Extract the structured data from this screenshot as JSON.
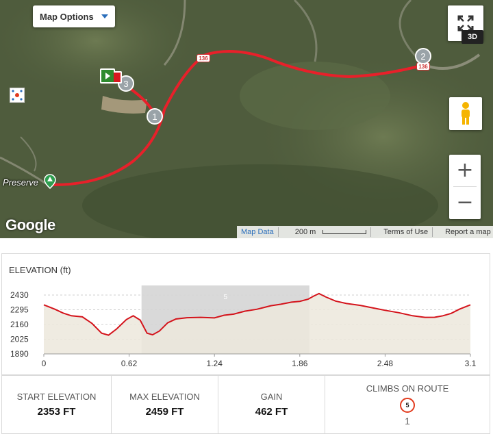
{
  "map": {
    "options_label": "Map Options",
    "btn_3d": "3D",
    "zoom_in": "+",
    "zoom_out": "−",
    "place_label": "Preserve",
    "google_logo": "Google",
    "road_shield_1": "136",
    "road_shield_2": "136",
    "waypoints": [
      "1",
      "2",
      "3"
    ],
    "attribution": {
      "map_data": "Map Data",
      "scale": "200 m",
      "terms": "Terms of Use",
      "report": "Report a map error"
    },
    "colors": {
      "route": "#e8202a",
      "link": "#2a6ebb"
    },
    "icons": [
      "fullscreen-icon",
      "pegman-icon",
      "compass-icon",
      "start-flag-icon",
      "end-marker-icon"
    ]
  },
  "elevation": {
    "title": "ELEVATION (ft)",
    "highlight_label": "5"
  },
  "chart_data": {
    "type": "area",
    "title": "ELEVATION (ft)",
    "xlabel": "",
    "ylabel": "",
    "xlim": [
      0,
      3.1
    ],
    "ylim": [
      1890,
      2430
    ],
    "xticks": [
      "0",
      "0.62",
      "1.24",
      "1.86",
      "2.48",
      "3.1"
    ],
    "yticks": [
      "2430",
      "2295",
      "2160",
      "2025",
      "1890"
    ],
    "highlight": {
      "label": "5",
      "x_start": 0.71,
      "x_end": 1.93
    },
    "x": [
      0,
      0.08,
      0.14,
      0.2,
      0.28,
      0.35,
      0.42,
      0.47,
      0.53,
      0.6,
      0.65,
      0.7,
      0.75,
      0.79,
      0.84,
      0.9,
      0.96,
      1.04,
      1.14,
      1.24,
      1.31,
      1.38,
      1.46,
      1.55,
      1.65,
      1.72,
      1.8,
      1.86,
      1.92,
      1.96,
      2.0,
      2.05,
      2.12,
      2.2,
      2.3,
      2.4,
      2.48,
      2.58,
      2.68,
      2.77,
      2.84,
      2.9,
      2.96,
      3.02,
      3.1
    ],
    "y": [
      2340,
      2300,
      2265,
      2240,
      2230,
      2170,
      2080,
      2062,
      2120,
      2205,
      2240,
      2200,
      2080,
      2065,
      2100,
      2175,
      2210,
      2222,
      2225,
      2220,
      2245,
      2255,
      2282,
      2300,
      2332,
      2345,
      2365,
      2372,
      2392,
      2420,
      2443,
      2412,
      2375,
      2352,
      2335,
      2310,
      2290,
      2268,
      2240,
      2225,
      2226,
      2240,
      2262,
      2300,
      2340
    ],
    "fill_color": "#ece8dc",
    "line_color": "#d4131b",
    "grid": true,
    "legend": "none"
  },
  "stats": [
    {
      "label": "START ELEVATION",
      "value": "2353 FT"
    },
    {
      "label": "MAX ELEVATION",
      "value": "2459 FT"
    },
    {
      "label": "GAIN",
      "value": "462 FT"
    },
    {
      "label": "CLIMBS ON ROUTE",
      "badge": "5",
      "value": "1"
    }
  ]
}
